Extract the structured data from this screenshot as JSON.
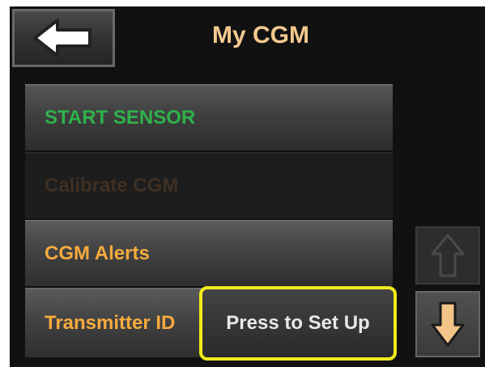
{
  "header": {
    "title": "My CGM",
    "back_icon": "arrow-left-icon"
  },
  "menu": {
    "items": [
      {
        "label": "START SENSOR",
        "state": "active",
        "color": "#2fb24b"
      },
      {
        "label": "Calibrate CGM",
        "state": "disabled",
        "color": "#3f3023"
      },
      {
        "label": "CGM Alerts",
        "state": "enabled",
        "color": "#f6ab3e"
      },
      {
        "label": "Transmitter ID",
        "state": "enabled",
        "color": "#f6ab3e"
      }
    ],
    "transmitter_action": "Press to Set Up"
  },
  "scroll": {
    "up_icon": "arrow-up-icon",
    "up_state": "disabled",
    "down_icon": "arrow-down-icon",
    "down_state": "enabled"
  },
  "colors": {
    "title": "#f4c98f",
    "highlight_border": "#f2ea1c",
    "arrow_active": "#f3c488",
    "arrow_disabled": "#3f3f3f"
  }
}
